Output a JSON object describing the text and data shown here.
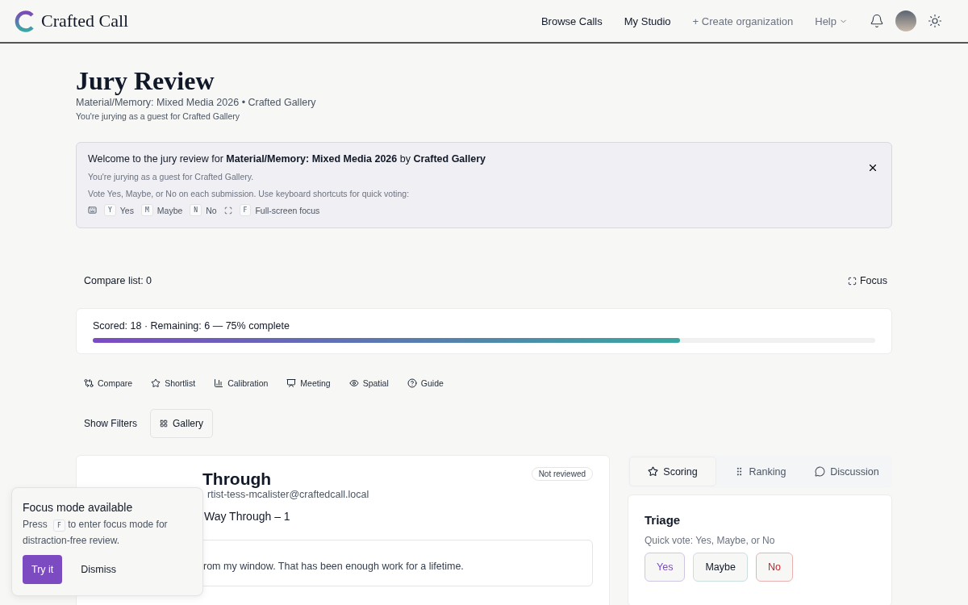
{
  "header": {
    "brand": "Crafted Call",
    "nav": [
      {
        "label": "Browse Calls",
        "kind": "main"
      },
      {
        "label": "My Studio",
        "kind": "main"
      },
      {
        "label": "+ Create organization",
        "kind": "muted"
      },
      {
        "label": "Help",
        "kind": "menu"
      }
    ]
  },
  "page": {
    "title": "Jury Review",
    "subtitle": "Material/Memory: Mixed Media 2026 • Crafted Gallery",
    "note": "You're jurying as a guest for Crafted Gallery"
  },
  "banner": {
    "title": "Welcome to the jury review for **Material/Memory: Mixed Media 2026** by **Crafted Gallery**",
    "lines": [
      "You're jurying as a guest for Crafted Gallery.",
      "Vote Yes, Maybe, or No on each submission. Use keyboard shortcuts for quick voting:"
    ],
    "shortcuts": [
      {
        "key": "Y",
        "label": "Yes",
        "kind": "vote"
      },
      {
        "key": "M",
        "label": "Maybe",
        "kind": "vote"
      },
      {
        "key": "N",
        "label": "No",
        "kind": "vote"
      },
      {
        "key": "F",
        "label": "Full-screen focus",
        "kind": "focus"
      }
    ]
  },
  "compare_list": "Compare list: 0",
  "focus_button": "Focus",
  "progress": {
    "label": "Scored: 18 · Remaining: 6 — 75% complete",
    "level": 0.75
  },
  "tools": [
    "Compare",
    "Shortlist",
    "Calibration",
    "Meeting",
    "Spatial",
    "Guide"
  ],
  "filters": {
    "show_filters": "Show Filters",
    "view": "Gallery"
  },
  "submission": {
    "title": "Through",
    "status": "Not reviewed",
    "email": "rtist-tess-mcalister@craftedcall.local",
    "work": "Way Through – 1",
    "statement": "rom my window. That has been enough work for a lifetime."
  },
  "side_tabs": [
    {
      "label": "Scoring",
      "selected": true
    },
    {
      "label": "Ranking",
      "selected": false
    },
    {
      "label": "Discussion",
      "selected": false
    }
  ],
  "triage": {
    "title": "Triage",
    "hint": "Quick vote: Yes, Maybe, or No",
    "votes": [
      {
        "label": "Yes",
        "kind": "yes"
      },
      {
        "label": "Maybe",
        "kind": "maybe"
      },
      {
        "label": "No",
        "kind": "no"
      }
    ]
  },
  "toast": {
    "title": "Focus mode available",
    "text_before": "Press",
    "key": "F",
    "text_after": "to enter focus mode for distraction-free review.",
    "primary": "Try it",
    "secondary": "Dismiss"
  }
}
